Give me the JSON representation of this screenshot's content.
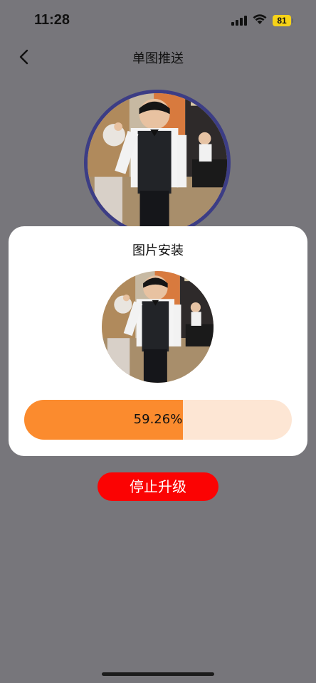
{
  "status_bar": {
    "time": "11:28",
    "battery": "81"
  },
  "nav": {
    "title": "单图推送"
  },
  "dialog": {
    "title": "图片安装"
  },
  "progress": {
    "value": 0.5926,
    "label": "59.26%"
  },
  "actions": {
    "stop_label": "停止升级"
  },
  "colors": {
    "progress_fill": "#fb8b2e",
    "progress_track": "#fde6d4",
    "stop_button": "#fb0303",
    "avatar_ring": "#3c3d85",
    "battery": "#f7d317"
  }
}
